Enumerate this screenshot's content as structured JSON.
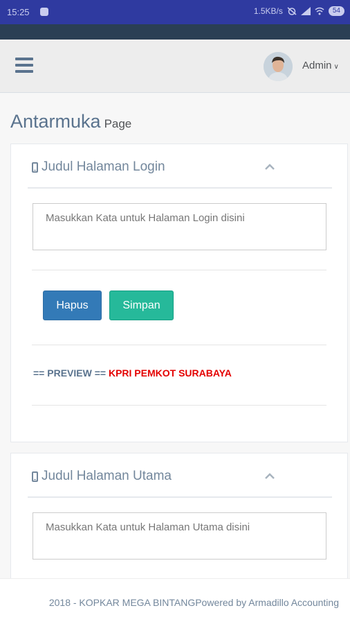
{
  "status_bar": {
    "time": "15:25",
    "net_speed": "1.5KB/s",
    "battery": "54"
  },
  "topnav": {
    "user_name": "Admin"
  },
  "page": {
    "title": "Antarmuka",
    "subtitle": "Page"
  },
  "panels": [
    {
      "title": "Judul Halaman Login",
      "placeholder": "Masukkan Kata untuk Halaman Login disini",
      "buttons": {
        "delete": "Hapus",
        "save": "Simpan"
      },
      "preview_label": "== PREVIEW ==",
      "preview_value": "KPRI PEMKOT SURABAYA"
    },
    {
      "title": "Judul Halaman Utama",
      "placeholder": "Masukkan Kata untuk Halaman Utama disini"
    }
  ],
  "footer": {
    "text": "2018 - KOPKAR MEGA BINTANGPowered by Armadillo Accounting"
  },
  "colors": {
    "status_bar": "#2f3aa0",
    "nav_dark": "#2a3f54",
    "btn_primary": "#337ab7",
    "btn_success": "#26b99a",
    "preview_value": "#e40000"
  }
}
